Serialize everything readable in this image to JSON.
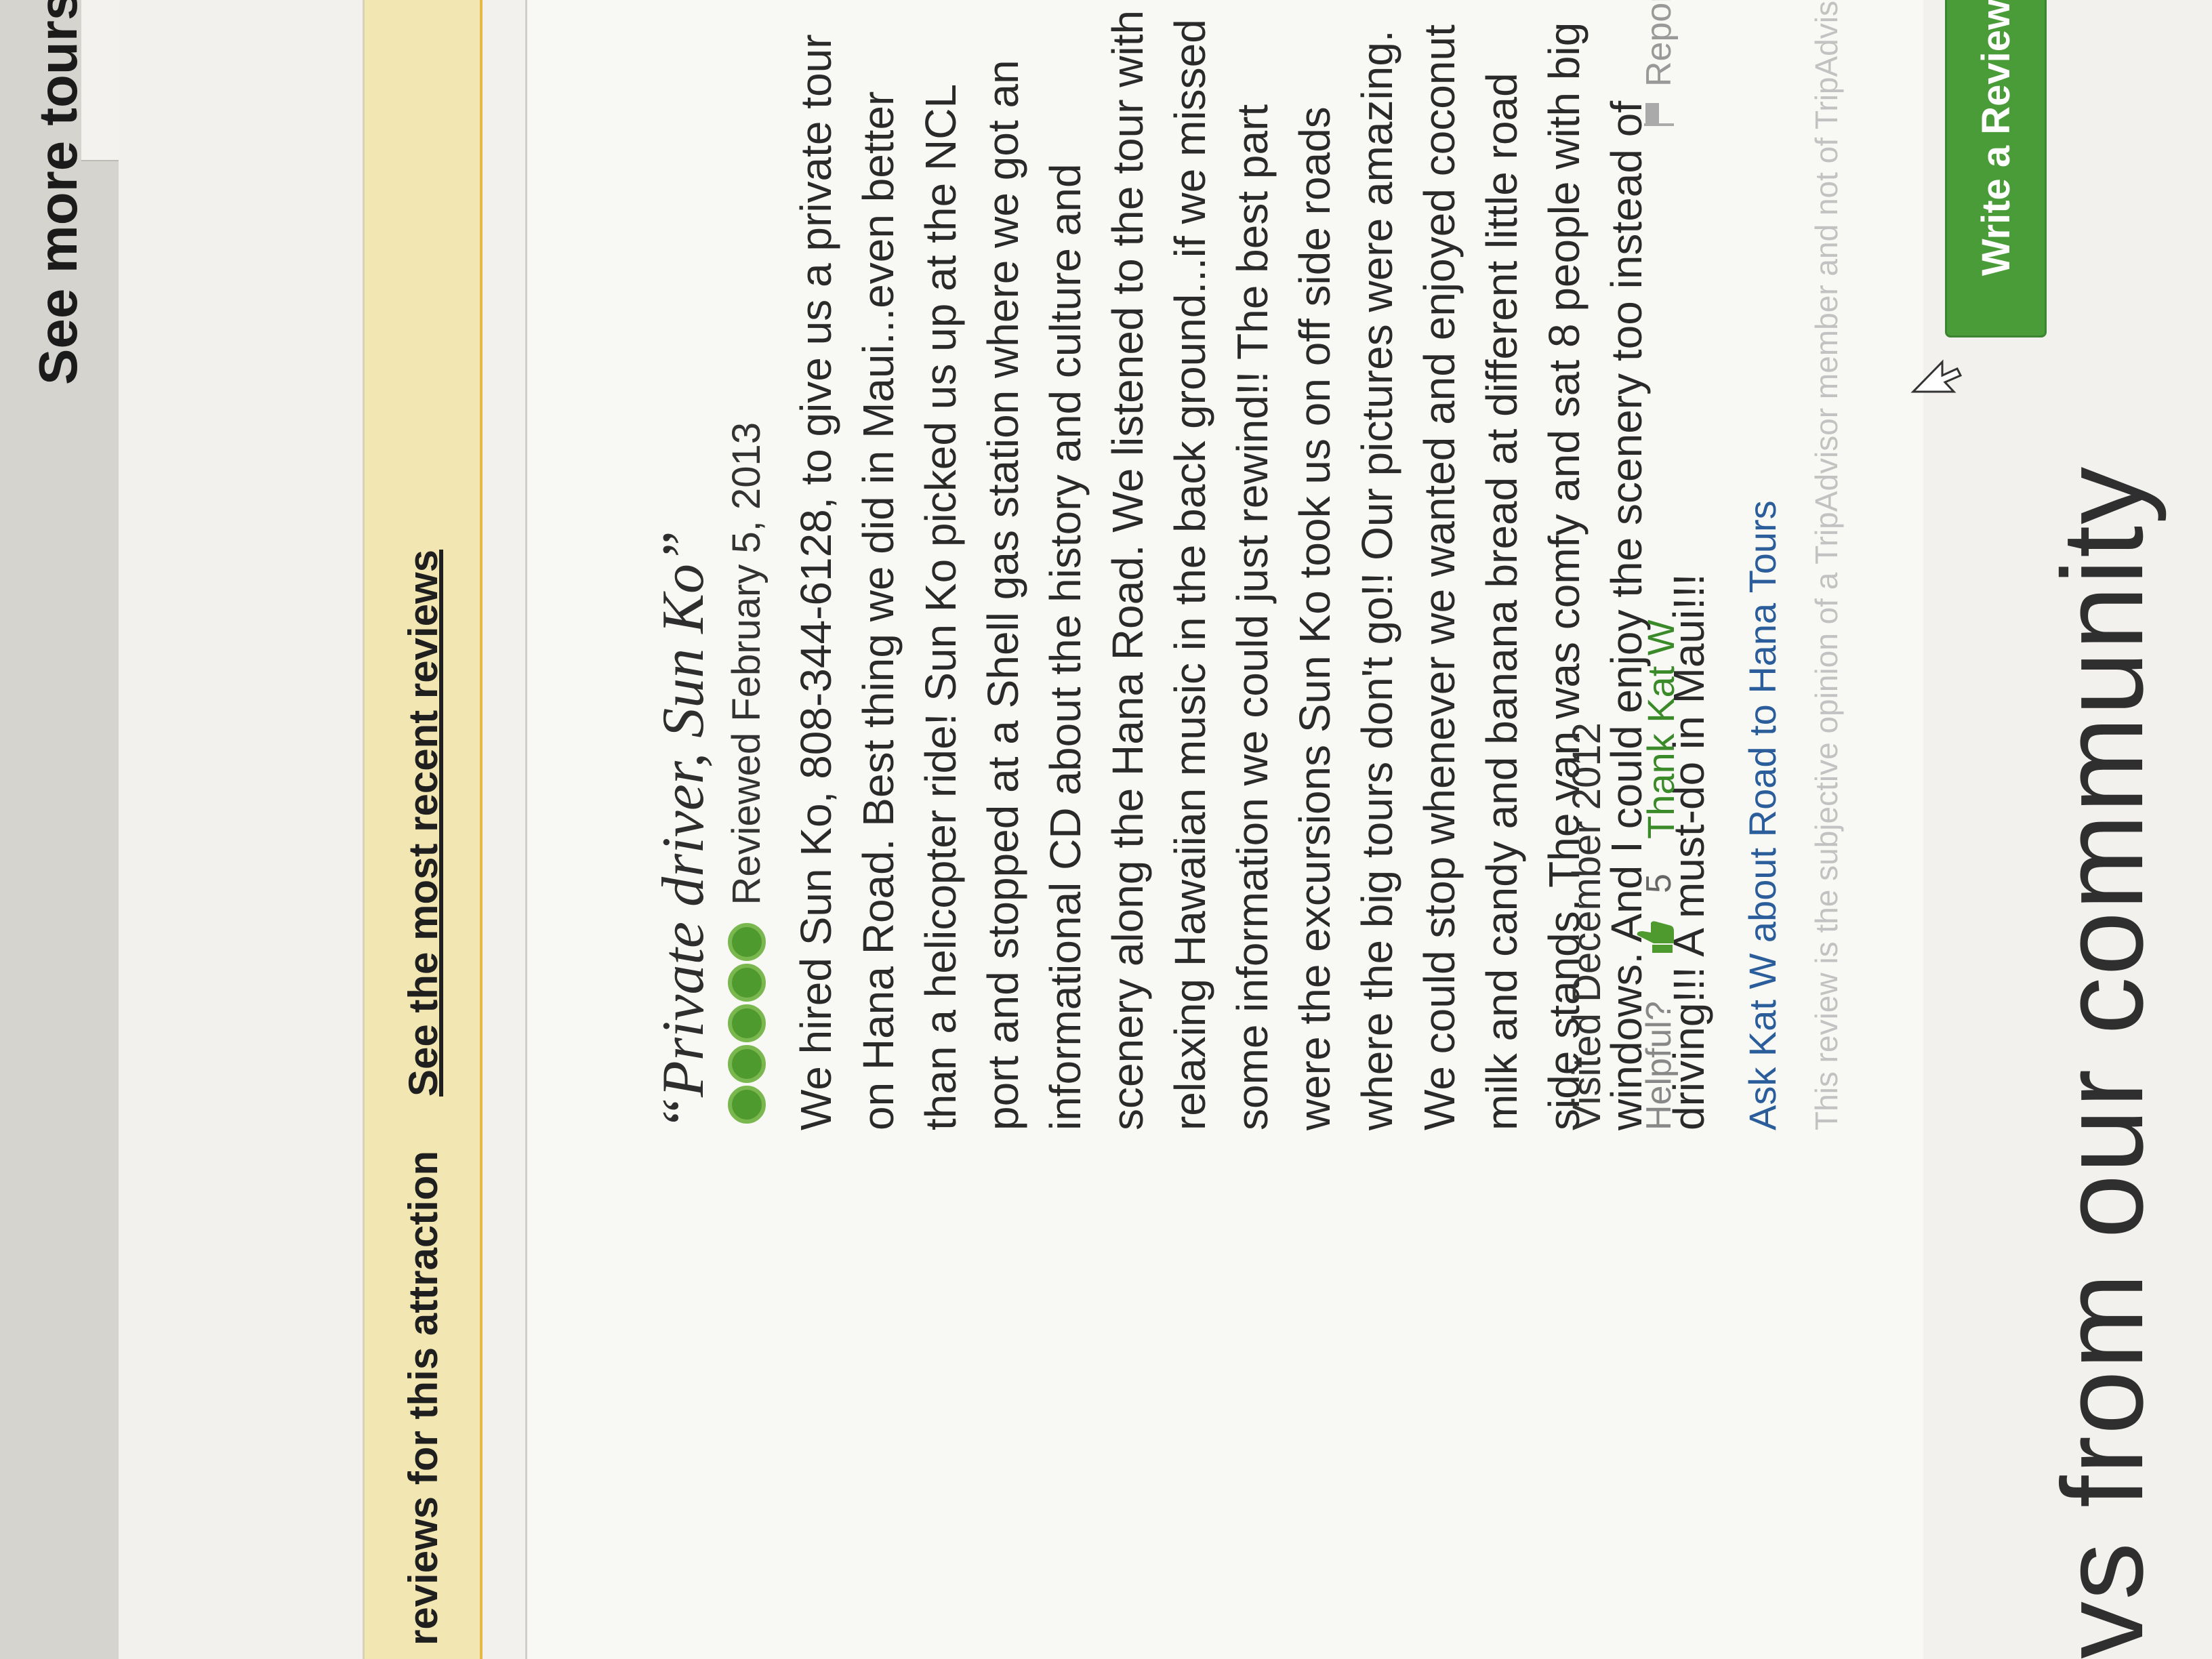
{
  "top_notice": {
    "text": "reviews for this attraction",
    "link": "See the most recent reviews"
  },
  "side_heading": "See more tours on Via",
  "review": {
    "title": "“Private driver, Sun Ko”",
    "rating": 5,
    "reviewed_date": "Reviewed February 5, 2013",
    "body": "We hired Sun Ko, 808-344-6128, to give us a private tour on Hana Road. Best thing we did in Maui...even better than a helicopter ride! Sun Ko picked us up at the NCL port and stopped at a Shell gas station where we got an informational CD about the history and culture and scenery along the Hana Road. We listened to the tour with relaxing Hawaiian music in the back ground...if we missed some information we could just rewind!! The best part were the excursions Sun Ko took us on off side roads where the big tours don't go!! Our pictures were amazing. We could stop whenever we wanted and enjoyed coconut milk and candy and banana bread at different little road side stands. The van was comfy and sat 8 people with big windows. And I could enjoy the scenery too instead of driving!!! A must-do in Maui!!!",
    "visited": "Visited December 2012",
    "helpful_label": "Helpful?",
    "helpful_count": "5",
    "thank_link": "Thank Kat W",
    "report_link": "Report",
    "ask_link": "Ask Kat W about Road to Hana Tours",
    "disclaimer": "This review is the subjective opinion of a TripAdvisor member and not of TripAdvisor LLC"
  },
  "community_heading": "vs from our community",
  "write_review_button": "Write a Review",
  "colors": {
    "notice_bg": "#f2e7b3",
    "rating_green": "#4f9a2f",
    "link_green": "#3b8a2a",
    "link_blue": "#2a5d9a",
    "button_green": "#4a9c39"
  },
  "icons": [
    "rating-bubble-icon",
    "thumbs-up-icon",
    "flag-icon",
    "mouse-cursor-icon"
  ]
}
